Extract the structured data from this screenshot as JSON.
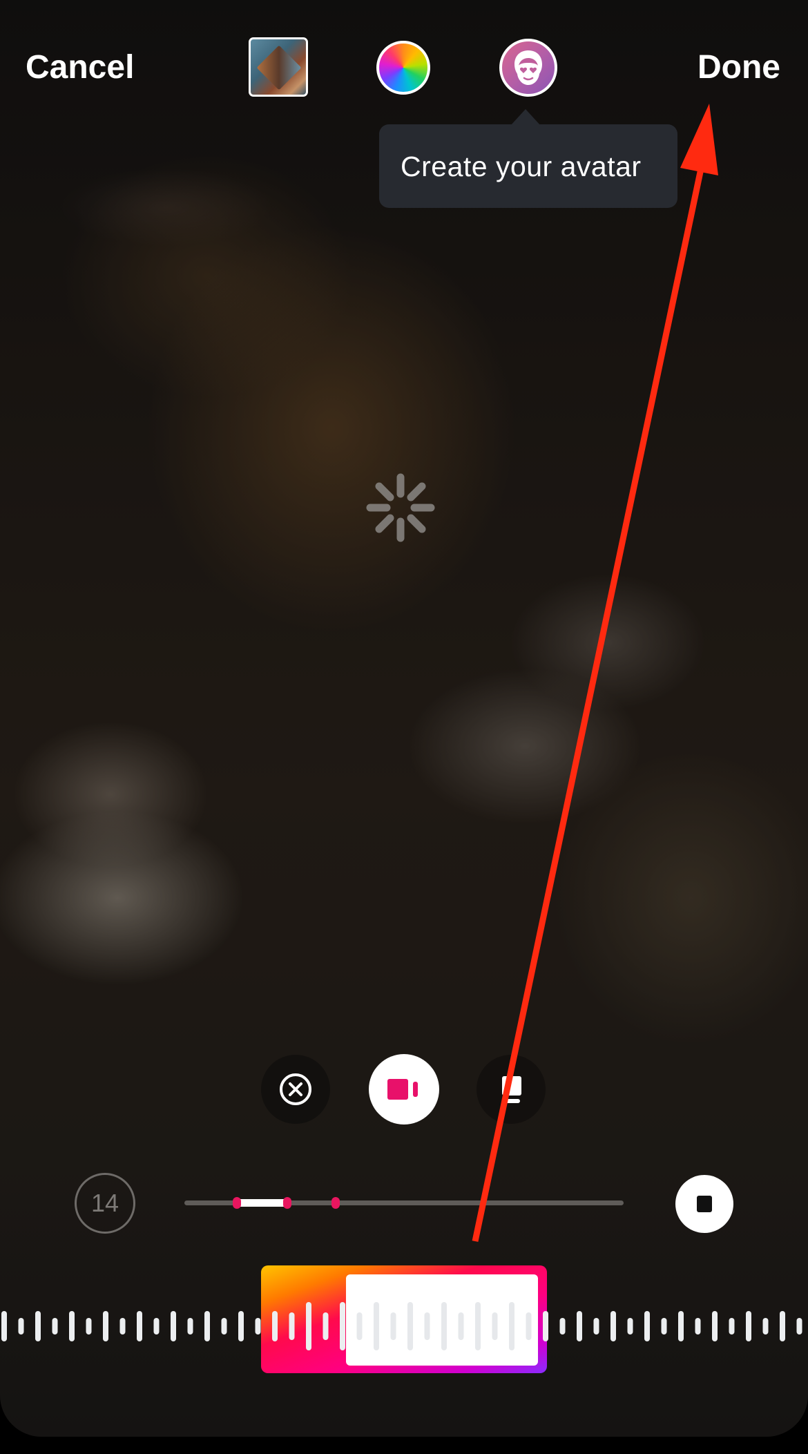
{
  "header": {
    "cancel_label": "Cancel",
    "done_label": "Done"
  },
  "toolbar": {
    "items": [
      {
        "name": "sticker-thumbnail",
        "icon": "isometric-room-thumbnail"
      },
      {
        "name": "color-picker",
        "icon": "color-wheel-icon"
      },
      {
        "name": "avatar",
        "icon": "avatar-face-icon"
      }
    ]
  },
  "tooltip": {
    "text": "Create your avatar"
  },
  "loading": {
    "icon": "spinner-icon"
  },
  "controls": {
    "discard_icon": "x-circle-icon",
    "clip_icon": "video-clip-icon",
    "layout_icon": "layout-icon"
  },
  "timeline": {
    "count": "14",
    "selection_start": 0.12,
    "selection_end": 0.235,
    "markers": [
      0.12,
      0.235,
      0.345
    ],
    "stop_icon": "stop-icon"
  },
  "audio_trim": {
    "selected_fraction": 0.6,
    "colors": {
      "gradient_start": "#ffc400",
      "gradient_mid": "#ff007f",
      "gradient_end": "#8a2cff"
    }
  },
  "annotation": {
    "arrow_color": "#ff2a10",
    "target": "done-button"
  }
}
